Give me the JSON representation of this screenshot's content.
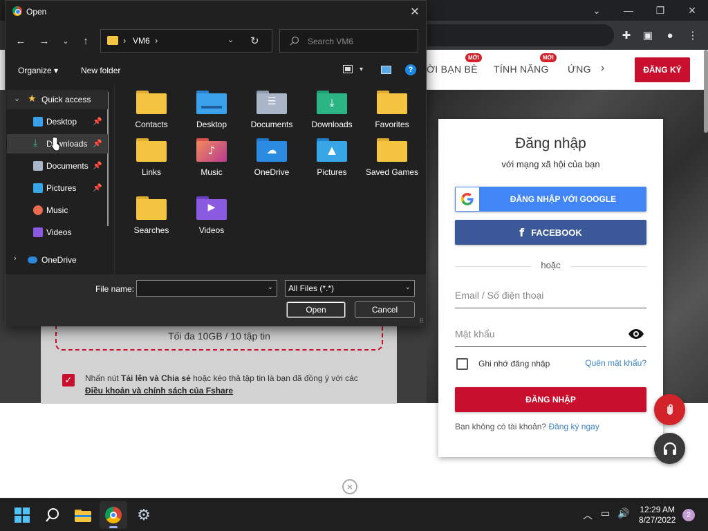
{
  "dialog": {
    "title": "Open",
    "address": {
      "path": "VM6",
      "search_placeholder": "Search VM6"
    },
    "commands": {
      "organize": "Organize",
      "new_folder": "New folder",
      "help": "?"
    },
    "nav_pane": [
      {
        "label": "Quick access",
        "icon": "star-icon",
        "pinned": false
      },
      {
        "label": "Desktop",
        "icon": "desktop-icon",
        "pinned": true
      },
      {
        "label": "Downloads",
        "icon": "downloads-icon",
        "pinned": true,
        "selected": true
      },
      {
        "label": "Documents",
        "icon": "documents-icon",
        "pinned": true
      },
      {
        "label": "Pictures",
        "icon": "pictures-icon",
        "pinned": true
      },
      {
        "label": "Music",
        "icon": "music-icon",
        "pinned": false
      },
      {
        "label": "Videos",
        "icon": "videos-icon",
        "pinned": false
      },
      {
        "label": "OneDrive",
        "icon": "onedrive-icon",
        "pinned": false
      }
    ],
    "files": [
      {
        "label": "Contacts",
        "icon": "folder-icon"
      },
      {
        "label": "Desktop",
        "icon": "desktop-folder-icon"
      },
      {
        "label": "Documents",
        "icon": "documents-folder-icon"
      },
      {
        "label": "Downloads",
        "icon": "downloads-folder-icon"
      },
      {
        "label": "Favorites",
        "icon": "folder-icon"
      },
      {
        "label": "Links",
        "icon": "folder-icon"
      },
      {
        "label": "Music",
        "icon": "music-folder-icon"
      },
      {
        "label": "OneDrive",
        "icon": "onedrive-folder-icon"
      },
      {
        "label": "Pictures",
        "icon": "pictures-folder-icon"
      },
      {
        "label": "Saved Games",
        "icon": "folder-icon"
      },
      {
        "label": "Searches",
        "icon": "folder-icon"
      },
      {
        "label": "Videos",
        "icon": "videos-folder-icon"
      }
    ],
    "file_name_label": "File name:",
    "file_name_value": "",
    "file_type": "All Files (*.*)",
    "open_label": "Open",
    "cancel_label": "Cancel"
  },
  "site": {
    "nav": [
      {
        "label": "ỜI BẠN BÈ",
        "badge": "MỚI"
      },
      {
        "label": "TÍNH NĂNG",
        "badge": "MỚI"
      },
      {
        "label": "ỨNG",
        "badge": ""
      }
    ],
    "signup": "ĐĂNG KÝ",
    "upload": {
      "limit": "Tối đa 10GB / 10 tập tin",
      "terms_prefix": "Nhấn nút ",
      "terms_bold": "Tải lên và Chia sẻ",
      "terms_mid": " hoặc kéo thả tập tin là bạn đã đồng ý với các",
      "terms_link": "Điều khoản và chính sách của Fshare"
    },
    "login": {
      "title": "Đăng nhập",
      "subtitle": "với mạng xã hội của bạn",
      "google": "ĐĂNG NHẬP VỚI GOOGLE",
      "facebook": "FACEBOOK",
      "or": "hoặc",
      "email_placeholder": "Email / Số điện thoại",
      "password_placeholder": "Mật khẩu",
      "remember": "Ghi nhớ đăng nhập",
      "forgot": "Quên mật khẩu?",
      "submit": "ĐĂNG NHẬP",
      "no_account": "Bạn không có tài khoản? ",
      "register": "Đăng ký ngay"
    }
  },
  "taskbar": {
    "time": "12:29 AM",
    "date": "8/27/2022",
    "notifications": "2"
  },
  "colors": {
    "brand_red": "#c8102e",
    "google_blue": "#4285f4",
    "facebook_blue": "#3b5998",
    "folder_yellow": "#f5c542"
  }
}
